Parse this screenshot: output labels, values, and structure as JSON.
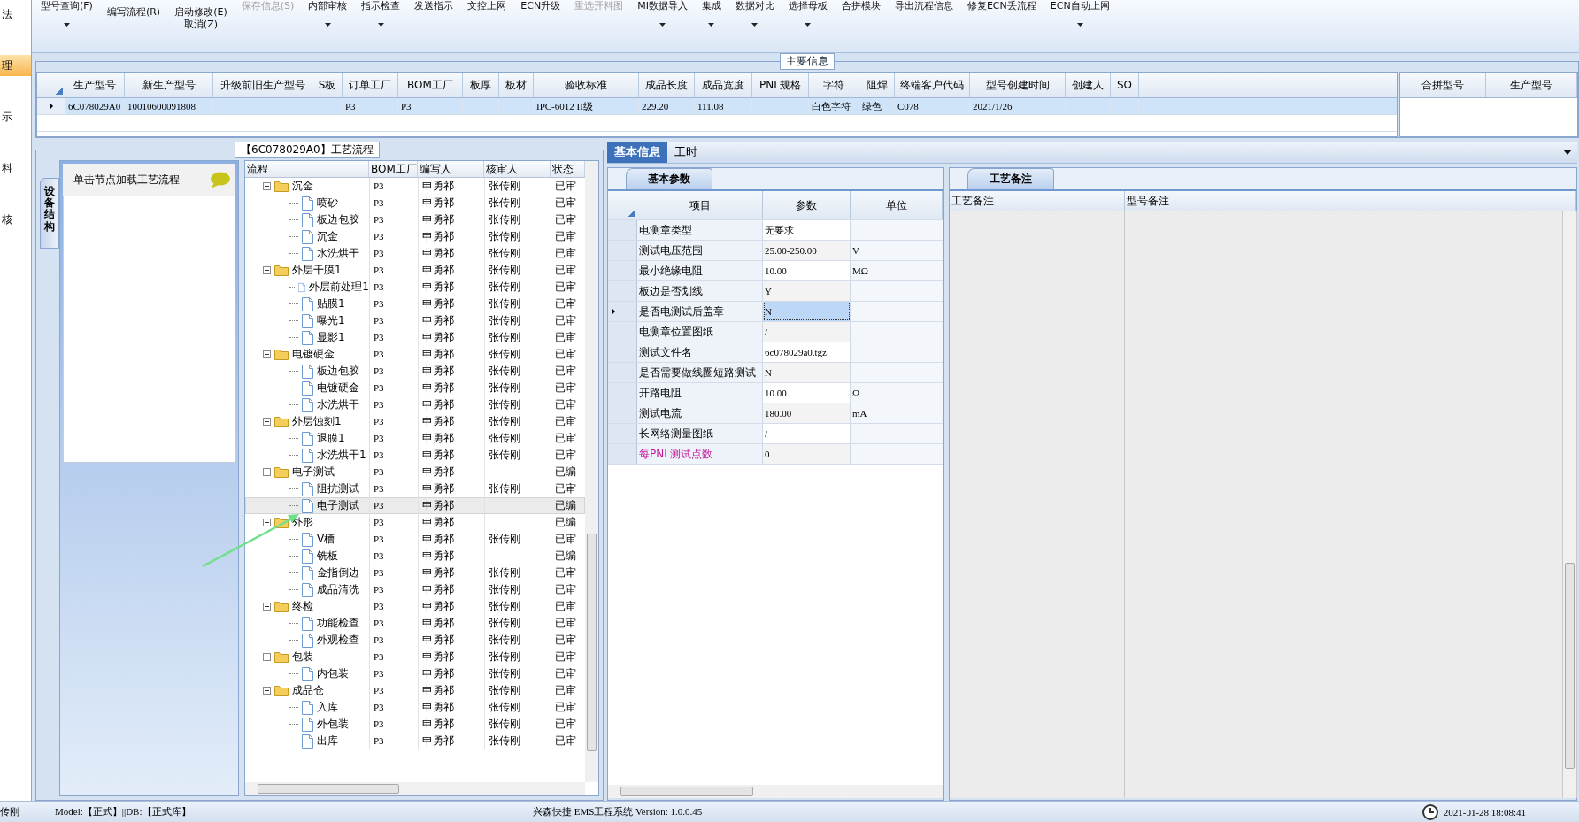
{
  "nav_strip": {
    "items": [
      {
        "label": "法",
        "selected": false
      },
      {
        "label": "理",
        "selected": true
      },
      {
        "label": "示",
        "selected": false
      },
      {
        "label": "料",
        "selected": false
      },
      {
        "label": "核",
        "selected": false
      }
    ]
  },
  "toolbar": {
    "buttons": [
      {
        "kind": "small",
        "label": "型号查询(F)",
        "disabled": false,
        "dropdown": true
      },
      {
        "kind": "large",
        "label": "编写流程(R)",
        "disabled": false,
        "dropdown": false
      },
      {
        "kind": "large",
        "label": "启动修改(E)",
        "disabled": false,
        "dropdown": false
      },
      {
        "kind": "sub",
        "label": "取消(Z)",
        "disabled": false,
        "dropdown": false
      },
      {
        "kind": "small",
        "label": "保存信息(S)",
        "disabled": true,
        "dropdown": false
      },
      {
        "kind": "small",
        "label": "内部审核",
        "disabled": false,
        "dropdown": true
      },
      {
        "kind": "small",
        "label": "指示检查",
        "disabled": false,
        "dropdown": true
      },
      {
        "kind": "small",
        "label": "发送指示",
        "disabled": false,
        "dropdown": false
      },
      {
        "kind": "small",
        "label": "文控上网",
        "disabled": false,
        "dropdown": false
      },
      {
        "kind": "small",
        "label": "ECN升级",
        "disabled": false,
        "dropdown": false
      },
      {
        "kind": "small",
        "label": "重选开料图",
        "disabled": true,
        "dropdown": false
      },
      {
        "kind": "small",
        "label": "MI数据导入",
        "disabled": false,
        "dropdown": true
      },
      {
        "kind": "small",
        "label": "集成",
        "disabled": false,
        "dropdown": true
      },
      {
        "kind": "small",
        "label": "数据对比",
        "disabled": false,
        "dropdown": true
      },
      {
        "kind": "small",
        "label": "选择母板",
        "disabled": false,
        "dropdown": true
      },
      {
        "kind": "small",
        "label": "合拼模块",
        "disabled": false,
        "dropdown": false
      },
      {
        "kind": "small",
        "label": "导出流程信息",
        "disabled": false,
        "dropdown": false
      },
      {
        "kind": "small",
        "label": "修复ECN丢流程",
        "disabled": false,
        "dropdown": false
      },
      {
        "kind": "small",
        "label": "ECN自动上网",
        "disabled": false,
        "dropdown": true
      }
    ]
  },
  "main_info": {
    "title": "主要信息",
    "columns": [
      "生产型号",
      "新生产型号",
      "升级前旧生产型号",
      "S板",
      "订单工厂",
      "BOM工厂",
      "板厚",
      "板材",
      "验收标准",
      "成品长度",
      "成品宽度",
      "PNL规格",
      "字符",
      "阻焊",
      "终端客户代码",
      "型号创建时间",
      "创建人",
      "SO"
    ],
    "rows": [
      {
        "selected": true,
        "cells": [
          "6C078029A0",
          "10010600091808",
          null,
          null,
          "P3",
          "P3",
          null,
          null,
          "IPC-6012 II级",
          "229.20",
          "111.08",
          null,
          "白色字符",
          "绿色",
          "C078",
          "2021/1/26",
          null,
          null
        ]
      }
    ],
    "side_columns": [
      "合拼型号",
      "生产型号"
    ]
  },
  "flow": {
    "title": "【6C078029A0】工艺流程",
    "side_tab": "设备结构",
    "hint": "单击节点加载工艺流程",
    "columns": [
      "流程",
      "BOM工厂",
      "编写人",
      "核审人",
      "状态"
    ],
    "nodes": [
      {
        "label": "沉金",
        "bom": "P3",
        "writer": "申勇祁",
        "reviewer": "张传刚",
        "status": "已审",
        "expanded": true,
        "selected": false,
        "children": [
          {
            "label": "喷砂",
            "bom": "P3",
            "writer": "申勇祁",
            "reviewer": "张传刚",
            "status": "已审",
            "selected": false
          },
          {
            "label": "板边包胶",
            "bom": "P3",
            "writer": "申勇祁",
            "reviewer": "张传刚",
            "status": "已审",
            "selected": false
          },
          {
            "label": "沉金",
            "bom": "P3",
            "writer": "申勇祁",
            "reviewer": "张传刚",
            "status": "已审",
            "selected": false
          },
          {
            "label": "水洗烘干",
            "bom": "P3",
            "writer": "申勇祁",
            "reviewer": "张传刚",
            "status": "已审",
            "selected": false
          }
        ]
      },
      {
        "label": "外层干膜1",
        "bom": "P3",
        "writer": "申勇祁",
        "reviewer": "张传刚",
        "status": "已审",
        "expanded": true,
        "selected": false,
        "children": [
          {
            "label": "外层前处理1",
            "bom": "P3",
            "writer": "申勇祁",
            "reviewer": "张传刚",
            "status": "已审",
            "selected": false
          },
          {
            "label": "贴膜1",
            "bom": "P3",
            "writer": "申勇祁",
            "reviewer": "张传刚",
            "status": "已审",
            "selected": false
          },
          {
            "label": "曝光1",
            "bom": "P3",
            "writer": "申勇祁",
            "reviewer": "张传刚",
            "status": "已审",
            "selected": false
          },
          {
            "label": "显影1",
            "bom": "P3",
            "writer": "申勇祁",
            "reviewer": "张传刚",
            "status": "已审",
            "selected": false
          }
        ]
      },
      {
        "label": "电镀硬金",
        "bom": "P3",
        "writer": "申勇祁",
        "reviewer": "张传刚",
        "status": "已审",
        "expanded": true,
        "selected": false,
        "children": [
          {
            "label": "板边包胶",
            "bom": "P3",
            "writer": "申勇祁",
            "reviewer": "张传刚",
            "status": "已审",
            "selected": false
          },
          {
            "label": "电镀硬金",
            "bom": "P3",
            "writer": "申勇祁",
            "reviewer": "张传刚",
            "status": "已审",
            "selected": false
          },
          {
            "label": "水洗烘干",
            "bom": "P3",
            "writer": "申勇祁",
            "reviewer": "张传刚",
            "status": "已审",
            "selected": false
          }
        ]
      },
      {
        "label": "外层蚀刻1",
        "bom": "P3",
        "writer": "申勇祁",
        "reviewer": "张传刚",
        "status": "已审",
        "expanded": true,
        "selected": false,
        "children": [
          {
            "label": "退膜1",
            "bom": "P3",
            "writer": "申勇祁",
            "reviewer": "张传刚",
            "status": "已审",
            "selected": false
          },
          {
            "label": "水洗烘干1",
            "bom": "P3",
            "writer": "申勇祁",
            "reviewer": "张传刚",
            "status": "已审",
            "selected": false
          }
        ]
      },
      {
        "label": "电子测试",
        "bom": "P3",
        "writer": "申勇祁",
        "status": "已编",
        "expanded": true,
        "selected": false,
        "children": [
          {
            "label": "阻抗测试",
            "bom": "P3",
            "writer": "申勇祁",
            "reviewer": "张传刚",
            "status": "已审",
            "selected": false
          },
          {
            "label": "电子测试",
            "bom": "P3",
            "writer": "申勇祁",
            "status": "已编",
            "selected": true
          }
        ]
      },
      {
        "label": "外形",
        "bom": "P3",
        "writer": "申勇祁",
        "status": "已编",
        "expanded": true,
        "selected": false,
        "children": [
          {
            "label": "V槽",
            "bom": "P3",
            "writer": "申勇祁",
            "reviewer": "张传刚",
            "status": "已审",
            "selected": false
          },
          {
            "label": "铣板",
            "bom": "P3",
            "writer": "申勇祁",
            "status": "已编",
            "selected": false
          },
          {
            "label": "金指倒边",
            "bom": "P3",
            "writer": "申勇祁",
            "reviewer": "张传刚",
            "status": "已审",
            "selected": false
          },
          {
            "label": "成品清洗",
            "bom": "P3",
            "writer": "申勇祁",
            "reviewer": "张传刚",
            "status": "已审",
            "selected": false
          }
        ]
      },
      {
        "label": "终检",
        "bom": "P3",
        "writer": "申勇祁",
        "reviewer": "张传刚",
        "status": "已审",
        "expanded": true,
        "selected": false,
        "children": [
          {
            "label": "功能检查",
            "bom": "P3",
            "writer": "申勇祁",
            "reviewer": "张传刚",
            "status": "已审",
            "selected": false
          },
          {
            "label": "外观检查",
            "bom": "P3",
            "writer": "申勇祁",
            "reviewer": "张传刚",
            "status": "已审",
            "selected": false
          }
        ]
      },
      {
        "label": "包装",
        "bom": "P3",
        "writer": "申勇祁",
        "reviewer": "张传刚",
        "status": "已审",
        "expanded": true,
        "selected": false,
        "children": [
          {
            "label": "内包装",
            "bom": "P3",
            "writer": "申勇祁",
            "reviewer": "张传刚",
            "status": "已审",
            "selected": false
          }
        ]
      },
      {
        "label": "成品仓",
        "bom": "P3",
        "writer": "申勇祁",
        "reviewer": "张传刚",
        "status": "已审",
        "expanded": true,
        "selected": false,
        "children": [
          {
            "label": "入库",
            "bom": "P3",
            "writer": "申勇祁",
            "reviewer": "张传刚",
            "status": "已审",
            "selected": false
          },
          {
            "label": "外包装",
            "bom": "P3",
            "writer": "申勇祁",
            "reviewer": "张传刚",
            "status": "已审",
            "selected": false
          },
          {
            "label": "出库",
            "bom": "P3",
            "writer": "申勇祁",
            "reviewer": "张传刚",
            "status": "已审",
            "selected": false
          }
        ]
      }
    ]
  },
  "info": {
    "tabs": [
      {
        "label": "基本信息",
        "selected": true
      },
      {
        "label": "工时",
        "selected": false
      }
    ],
    "params": {
      "tab": "基本参数",
      "columns": [
        "项目",
        "参数",
        "单位"
      ],
      "rows": [
        {
          "item": "电测章类型",
          "value": "无要求",
          "selected": false,
          "flagged": false
        },
        {
          "item": "测试电压范围",
          "value": "25.00-250.00",
          "unit": "V",
          "selected": false,
          "flagged": false
        },
        {
          "item": "最小绝缘电阻",
          "value": "10.00",
          "unit": "MΩ",
          "selected": false,
          "flagged": false
        },
        {
          "item": "板边是否划线",
          "value": "Y",
          "selected": false,
          "flagged": false
        },
        {
          "item": "是否电测试后盖章",
          "value": "N",
          "selected": true,
          "flagged": false
        },
        {
          "item": "电测章位置图纸",
          "value": "/",
          "selected": false,
          "flagged": false
        },
        {
          "item": "测试文件名",
          "value": "6c078029a0.tgz",
          "selected": false,
          "flagged": false
        },
        {
          "item": "是否需要做线圈短路测试",
          "value": "N",
          "selected": false,
          "flagged": false
        },
        {
          "item": "开路电阻",
          "value": "10.00",
          "unit": "Ω",
          "selected": false,
          "flagged": false
        },
        {
          "item": "测试电流",
          "value": "180.00",
          "unit": "mA",
          "selected": false,
          "flagged": false
        },
        {
          "item": "长网络测量图纸",
          "value": "/",
          "selected": false,
          "flagged": false
        },
        {
          "item": "每PNL测试点数",
          "value": "0",
          "selected": false,
          "flagged": true
        }
      ]
    },
    "notes": {
      "tab": "工艺备注",
      "columns": [
        "工艺备注",
        "型号备注"
      ]
    }
  },
  "status_bar": {
    "user": "传刚",
    "mode": "Model:【正式】||DB:【正式库】",
    "app": "兴森快捷 EMS工程系统 Version: 1.0.0.45",
    "time": "2021-01-28 18:08:41"
  }
}
